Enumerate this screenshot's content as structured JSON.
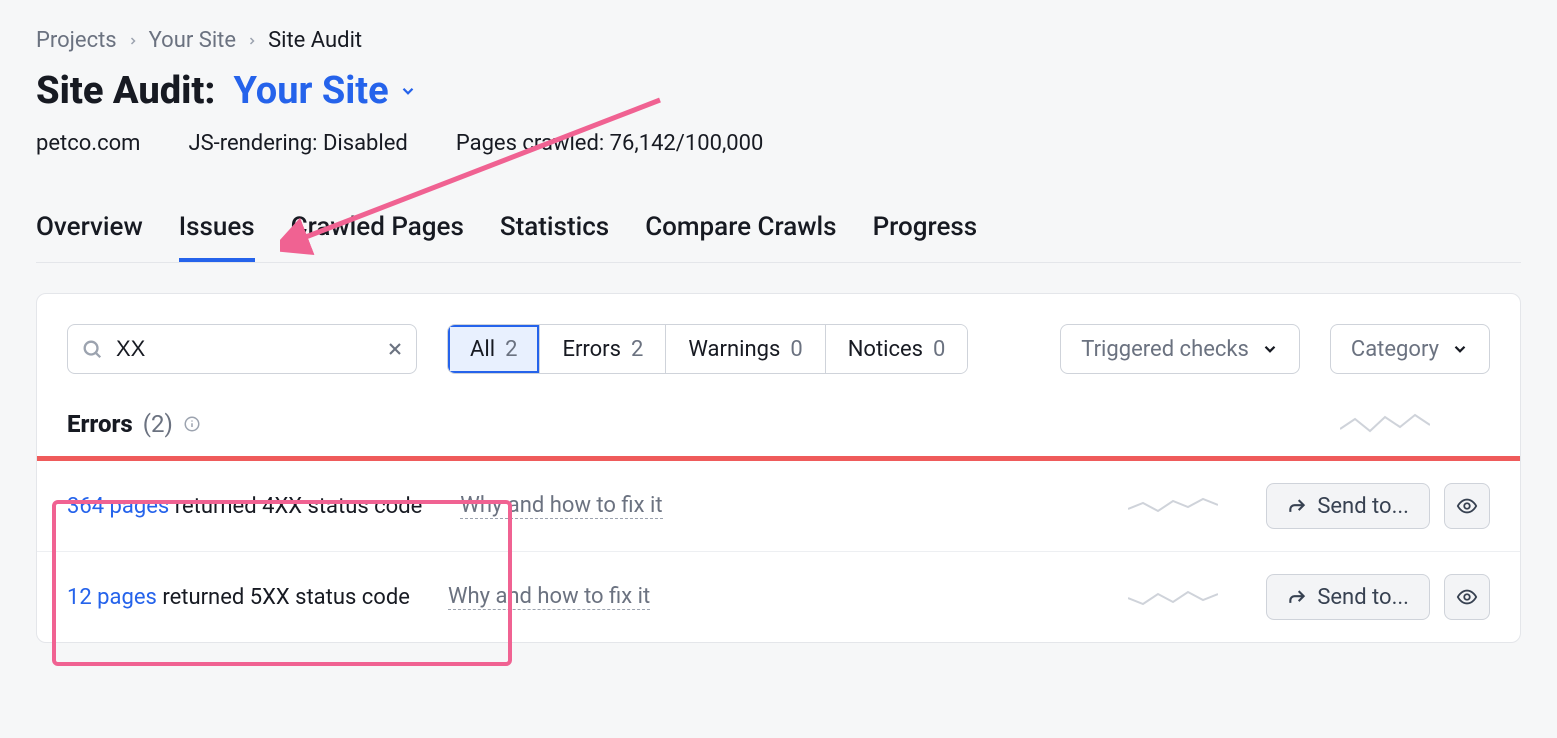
{
  "breadcrumb": {
    "items": [
      "Projects",
      "Your Site",
      "Site Audit"
    ]
  },
  "title": {
    "static": "Site Audit:",
    "site": "Your Site"
  },
  "meta": {
    "domain": "petco.com",
    "js_rendering": "JS-rendering: Disabled",
    "pages_crawled": "Pages crawled: 76,142/100,000"
  },
  "tabs": [
    "Overview",
    "Issues",
    "Crawled Pages",
    "Statistics",
    "Compare Crawls",
    "Progress"
  ],
  "active_tab": "Issues",
  "search": {
    "value": "XX"
  },
  "filters": {
    "items": [
      {
        "label": "All",
        "count": "2",
        "active": true
      },
      {
        "label": "Errors",
        "count": "2",
        "active": false
      },
      {
        "label": "Warnings",
        "count": "0",
        "active": false
      },
      {
        "label": "Notices",
        "count": "0",
        "active": false
      }
    ]
  },
  "dropdowns": {
    "triggered": "Triggered checks",
    "category": "Category"
  },
  "errors_header": {
    "label": "Errors",
    "count": "(2)"
  },
  "issues": [
    {
      "count_text": "364 pages",
      "rest": " returned 4XX status code",
      "why": "Why and how to fix it",
      "send": "Send to..."
    },
    {
      "count_text": "12 pages",
      "rest": " returned 5XX status code",
      "why": "Why and how to fix it",
      "send": "Send to..."
    }
  ]
}
